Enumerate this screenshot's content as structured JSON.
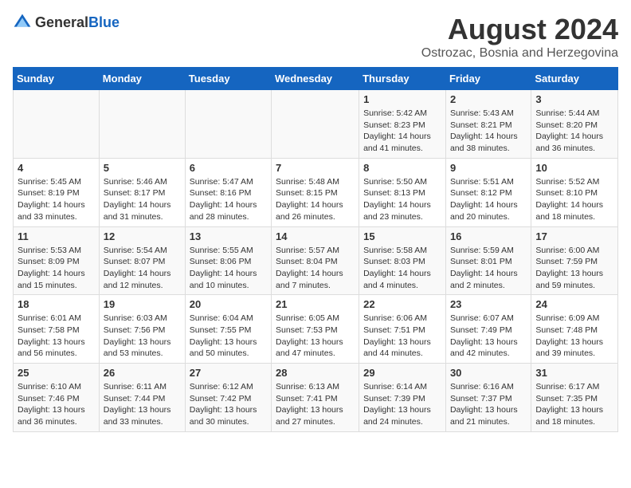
{
  "header": {
    "logo_general": "General",
    "logo_blue": "Blue",
    "month_year": "August 2024",
    "location": "Ostrozac, Bosnia and Herzegovina"
  },
  "weekdays": [
    "Sunday",
    "Monday",
    "Tuesday",
    "Wednesday",
    "Thursday",
    "Friday",
    "Saturday"
  ],
  "weeks": [
    [
      {
        "day": "",
        "info": ""
      },
      {
        "day": "",
        "info": ""
      },
      {
        "day": "",
        "info": ""
      },
      {
        "day": "",
        "info": ""
      },
      {
        "day": "1",
        "info": "Sunrise: 5:42 AM\nSunset: 8:23 PM\nDaylight: 14 hours and 41 minutes."
      },
      {
        "day": "2",
        "info": "Sunrise: 5:43 AM\nSunset: 8:21 PM\nDaylight: 14 hours and 38 minutes."
      },
      {
        "day": "3",
        "info": "Sunrise: 5:44 AM\nSunset: 8:20 PM\nDaylight: 14 hours and 36 minutes."
      }
    ],
    [
      {
        "day": "4",
        "info": "Sunrise: 5:45 AM\nSunset: 8:19 PM\nDaylight: 14 hours and 33 minutes."
      },
      {
        "day": "5",
        "info": "Sunrise: 5:46 AM\nSunset: 8:17 PM\nDaylight: 14 hours and 31 minutes."
      },
      {
        "day": "6",
        "info": "Sunrise: 5:47 AM\nSunset: 8:16 PM\nDaylight: 14 hours and 28 minutes."
      },
      {
        "day": "7",
        "info": "Sunrise: 5:48 AM\nSunset: 8:15 PM\nDaylight: 14 hours and 26 minutes."
      },
      {
        "day": "8",
        "info": "Sunrise: 5:50 AM\nSunset: 8:13 PM\nDaylight: 14 hours and 23 minutes."
      },
      {
        "day": "9",
        "info": "Sunrise: 5:51 AM\nSunset: 8:12 PM\nDaylight: 14 hours and 20 minutes."
      },
      {
        "day": "10",
        "info": "Sunrise: 5:52 AM\nSunset: 8:10 PM\nDaylight: 14 hours and 18 minutes."
      }
    ],
    [
      {
        "day": "11",
        "info": "Sunrise: 5:53 AM\nSunset: 8:09 PM\nDaylight: 14 hours and 15 minutes."
      },
      {
        "day": "12",
        "info": "Sunrise: 5:54 AM\nSunset: 8:07 PM\nDaylight: 14 hours and 12 minutes."
      },
      {
        "day": "13",
        "info": "Sunrise: 5:55 AM\nSunset: 8:06 PM\nDaylight: 14 hours and 10 minutes."
      },
      {
        "day": "14",
        "info": "Sunrise: 5:57 AM\nSunset: 8:04 PM\nDaylight: 14 hours and 7 minutes."
      },
      {
        "day": "15",
        "info": "Sunrise: 5:58 AM\nSunset: 8:03 PM\nDaylight: 14 hours and 4 minutes."
      },
      {
        "day": "16",
        "info": "Sunrise: 5:59 AM\nSunset: 8:01 PM\nDaylight: 14 hours and 2 minutes."
      },
      {
        "day": "17",
        "info": "Sunrise: 6:00 AM\nSunset: 7:59 PM\nDaylight: 13 hours and 59 minutes."
      }
    ],
    [
      {
        "day": "18",
        "info": "Sunrise: 6:01 AM\nSunset: 7:58 PM\nDaylight: 13 hours and 56 minutes."
      },
      {
        "day": "19",
        "info": "Sunrise: 6:03 AM\nSunset: 7:56 PM\nDaylight: 13 hours and 53 minutes."
      },
      {
        "day": "20",
        "info": "Sunrise: 6:04 AM\nSunset: 7:55 PM\nDaylight: 13 hours and 50 minutes."
      },
      {
        "day": "21",
        "info": "Sunrise: 6:05 AM\nSunset: 7:53 PM\nDaylight: 13 hours and 47 minutes."
      },
      {
        "day": "22",
        "info": "Sunrise: 6:06 AM\nSunset: 7:51 PM\nDaylight: 13 hours and 44 minutes."
      },
      {
        "day": "23",
        "info": "Sunrise: 6:07 AM\nSunset: 7:49 PM\nDaylight: 13 hours and 42 minutes."
      },
      {
        "day": "24",
        "info": "Sunrise: 6:09 AM\nSunset: 7:48 PM\nDaylight: 13 hours and 39 minutes."
      }
    ],
    [
      {
        "day": "25",
        "info": "Sunrise: 6:10 AM\nSunset: 7:46 PM\nDaylight: 13 hours and 36 minutes."
      },
      {
        "day": "26",
        "info": "Sunrise: 6:11 AM\nSunset: 7:44 PM\nDaylight: 13 hours and 33 minutes."
      },
      {
        "day": "27",
        "info": "Sunrise: 6:12 AM\nSunset: 7:42 PM\nDaylight: 13 hours and 30 minutes."
      },
      {
        "day": "28",
        "info": "Sunrise: 6:13 AM\nSunset: 7:41 PM\nDaylight: 13 hours and 27 minutes."
      },
      {
        "day": "29",
        "info": "Sunrise: 6:14 AM\nSunset: 7:39 PM\nDaylight: 13 hours and 24 minutes."
      },
      {
        "day": "30",
        "info": "Sunrise: 6:16 AM\nSunset: 7:37 PM\nDaylight: 13 hours and 21 minutes."
      },
      {
        "day": "31",
        "info": "Sunrise: 6:17 AM\nSunset: 7:35 PM\nDaylight: 13 hours and 18 minutes."
      }
    ]
  ]
}
